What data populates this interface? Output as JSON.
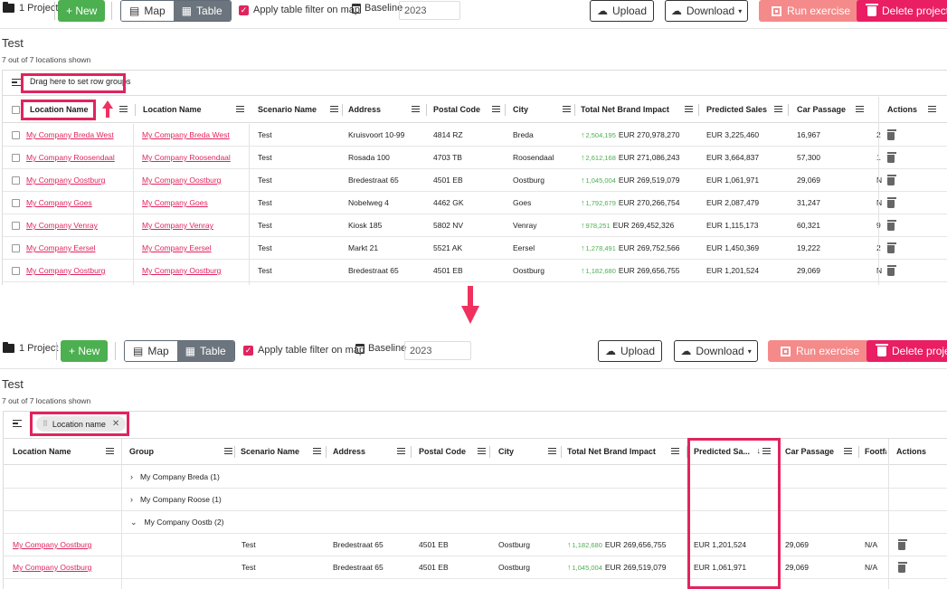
{
  "toolbar": {
    "project_count": "1 Project",
    "new_label": "+ New",
    "map_label": "Map",
    "table_label": "Table",
    "filter_label": "Apply table filter on map",
    "baseline_label": "Baseline",
    "baseline_value": "2023",
    "upload_label": "Upload",
    "download_label": "Download",
    "run_label": "Run exercise",
    "delete_label": "Delete project"
  },
  "page": {
    "title": "Test",
    "shown": "7 out of 7 locations shown"
  },
  "before": {
    "group_hint": "Drag here to set row groups",
    "columns": [
      "Location Name",
      "Location Name",
      "Scenario Name",
      "Address",
      "Postal Code",
      "City",
      "Total Net Brand Impact",
      "Predicted Sales",
      "Car Passage",
      "",
      "Actions"
    ],
    "rows": [
      {
        "loc": "My Company Breda West",
        "loc2": "My Company Breda West",
        "scenario": "Test",
        "address": "Kruisvoort 10-99",
        "postal": "4814 RZ",
        "city": "Breda",
        "tnbi_delta": "2,504,195",
        "tnbi": "EUR 270,978,270",
        "sales": "EUR 3,225,460",
        "car": "16,967",
        "extra": "2"
      },
      {
        "loc": "My Company Roosendaal",
        "loc2": "My Company Roosendaal",
        "scenario": "Test",
        "address": "Rosada 100",
        "postal": "4703 TB",
        "city": "Roosendaal",
        "tnbi_delta": "2,612,168",
        "tnbi": "EUR 271,086,243",
        "sales": "EUR 3,664,837",
        "car": "57,300",
        "extra": "1"
      },
      {
        "loc": "My Company Oostburg",
        "loc2": "My Company Oostburg",
        "scenario": "Test",
        "address": "Bredestraat 65",
        "postal": "4501 EB",
        "city": "Oostburg",
        "tnbi_delta": "1,045,004",
        "tnbi": "EUR 269,519,079",
        "sales": "EUR 1,061,971",
        "car": "29,069",
        "extra": "N"
      },
      {
        "loc": "My Company Goes",
        "loc2": "My Company Goes",
        "scenario": "Test",
        "address": "Nobelweg 4",
        "postal": "4462 GK",
        "city": "Goes",
        "tnbi_delta": "1,792,679",
        "tnbi": "EUR 270,266,754",
        "sales": "EUR 2,087,479",
        "car": "31,247",
        "extra": "N"
      },
      {
        "loc": "My Company Venray",
        "loc2": "My Company Venray",
        "scenario": "Test",
        "address": "Kiosk 185",
        "postal": "5802 NV",
        "city": "Venray",
        "tnbi_delta": "978,251",
        "tnbi": "EUR 269,452,326",
        "sales": "EUR 1,115,173",
        "car": "60,321",
        "extra": "9"
      },
      {
        "loc": "My Company Eersel",
        "loc2": "My Company Eersel",
        "scenario": "Test",
        "address": "Markt 21",
        "postal": "5521 AK",
        "city": "Eersel",
        "tnbi_delta": "1,278,491",
        "tnbi": "EUR 269,752,566",
        "sales": "EUR 1,450,369",
        "car": "19,222",
        "extra": "2"
      },
      {
        "loc": "My Company Oostburg",
        "loc2": "My Company Oostburg",
        "scenario": "Test",
        "address": "Bredestraat 65",
        "postal": "4501 EB",
        "city": "Oostburg",
        "tnbi_delta": "1,182,680",
        "tnbi": "EUR 269,656,755",
        "sales": "EUR 1,201,524",
        "car": "29,069",
        "extra": "N"
      }
    ]
  },
  "after": {
    "chip_label": "Location name",
    "columns": [
      "Location Name",
      "Group",
      "Scenario Name",
      "Address",
      "Postal Code",
      "City",
      "Total Net Brand Impact",
      "Predicted Sa...",
      "Car Passage",
      "Footfa",
      "Actions"
    ],
    "groups": [
      {
        "caret": "›",
        "label": "My Company Breda (1)"
      },
      {
        "caret": "›",
        "label": "My Company Roose (1)"
      },
      {
        "caret": "⌄",
        "label": "My Company Oostb (2)"
      }
    ],
    "rows": [
      {
        "loc": "My Company Oostburg",
        "scenario": "Test",
        "address": "Bredestraat 65",
        "postal": "4501 EB",
        "city": "Oostburg",
        "tnbi_delta": "1,182,680",
        "tnbi": "EUR 269,656,755",
        "sales": "EUR 1,201,524",
        "car": "29,069",
        "foot": "N/A"
      },
      {
        "loc": "My Company Oostburg",
        "scenario": "Test",
        "address": "Bredestraat 65",
        "postal": "4501 EB",
        "city": "Oostburg",
        "tnbi_delta": "1,045,004",
        "tnbi": "EUR 269,519,079",
        "sales": "EUR 1,061,971",
        "car": "29,069",
        "foot": "N/A"
      }
    ]
  },
  "colors": {
    "accent": "#e0245e",
    "new": "#4caf50",
    "run": "#f58a8a",
    "delete": "#e91e63",
    "highlight": "#e0245e"
  }
}
